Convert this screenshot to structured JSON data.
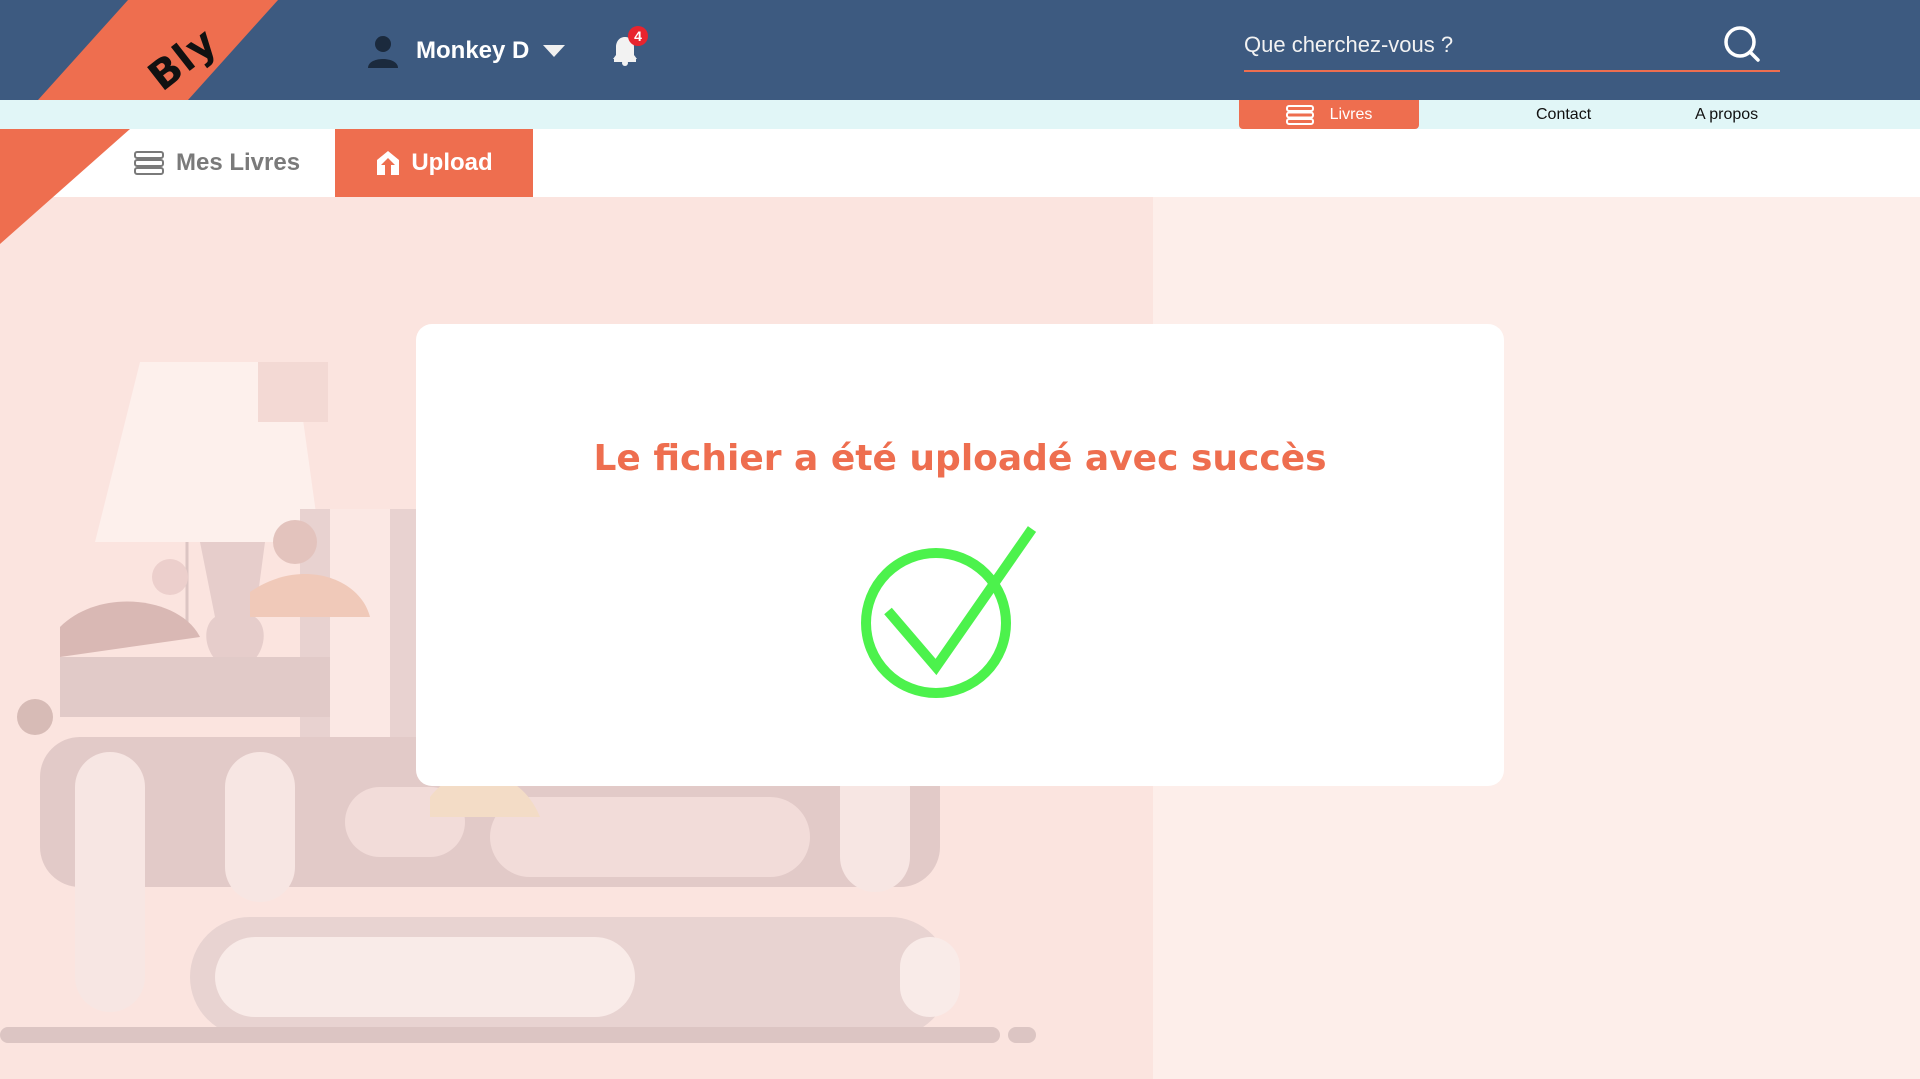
{
  "brand": {
    "logo_text": "Bly",
    "accent": "#ee6e4f",
    "header_bg": "#3d5a80"
  },
  "header": {
    "user_name": "Monkey D",
    "notification_count": "4",
    "search_placeholder": "Que cherchez-vous ?"
  },
  "subnav": {
    "items": [
      {
        "label": "Livres",
        "icon": "books-icon",
        "active": true
      },
      {
        "label": "Contact",
        "active": false
      },
      {
        "label": "A propos",
        "active": false
      }
    ]
  },
  "tabs": [
    {
      "label": "Mes Livres",
      "icon": "books-icon",
      "active": false
    },
    {
      "label": "Upload",
      "icon": "upload-icon",
      "active": true
    }
  ],
  "modal": {
    "message": "Le fichier a été uploadé avec succès",
    "icon": "check-circle-icon",
    "icon_color": "#4cf24c"
  }
}
